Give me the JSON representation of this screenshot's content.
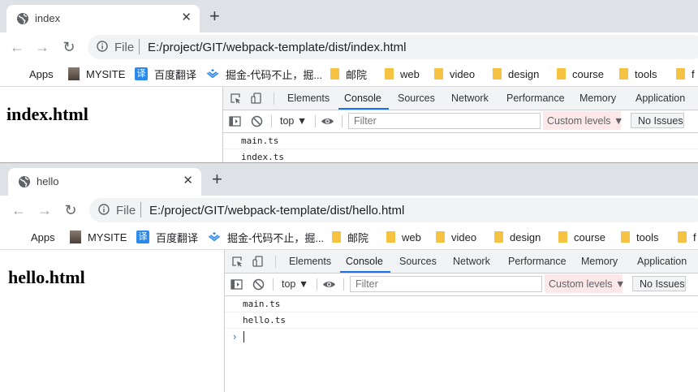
{
  "colors": {
    "accent": "#1a73e8",
    "folder": "#f5c242",
    "tabbar": "#dee1e6",
    "custom_levels_bg": "#fce8e8"
  },
  "bookmarks": [
    {
      "label": "Apps",
      "icon": "apps-grid-icon"
    },
    {
      "label": "MYSITE",
      "icon": "mysite-icon"
    },
    {
      "label": "百度翻译",
      "icon": "fanyi-icon"
    },
    {
      "label": "掘金-代码不止，掘...",
      "icon": "juejin-icon"
    },
    {
      "label": "邮院",
      "icon": "folder-icon"
    },
    {
      "label": "web",
      "icon": "folder-icon"
    },
    {
      "label": "video",
      "icon": "folder-icon"
    },
    {
      "label": "design",
      "icon": "folder-icon"
    },
    {
      "label": "course",
      "icon": "folder-icon"
    },
    {
      "label": "tools",
      "icon": "folder-icon"
    },
    {
      "label": "f",
      "icon": "folder-icon"
    }
  ],
  "devtools": {
    "tabs": [
      "Elements",
      "Console",
      "Sources",
      "Network",
      "Performance",
      "Memory",
      "Application"
    ],
    "active_tab": "Console",
    "context": "top ▼",
    "filter_placeholder": "Filter",
    "levels": "Custom levels ▼",
    "issues": "No Issues"
  },
  "windows": [
    {
      "tab_title": "index",
      "close": "✕",
      "new_tab": "+",
      "scheme": "File",
      "url": "E:/project/GIT/webpack-template/dist/index.html",
      "heading": "index.html",
      "console_lines": [
        "main.ts",
        "index.ts"
      ]
    },
    {
      "tab_title": "hello",
      "close": "✕",
      "new_tab": "+",
      "scheme": "File",
      "url": "E:/project/GIT/webpack-template/dist/hello.html",
      "heading": "hello.html",
      "console_lines": [
        "main.ts",
        "hello.ts"
      ],
      "prompt": "›"
    }
  ]
}
